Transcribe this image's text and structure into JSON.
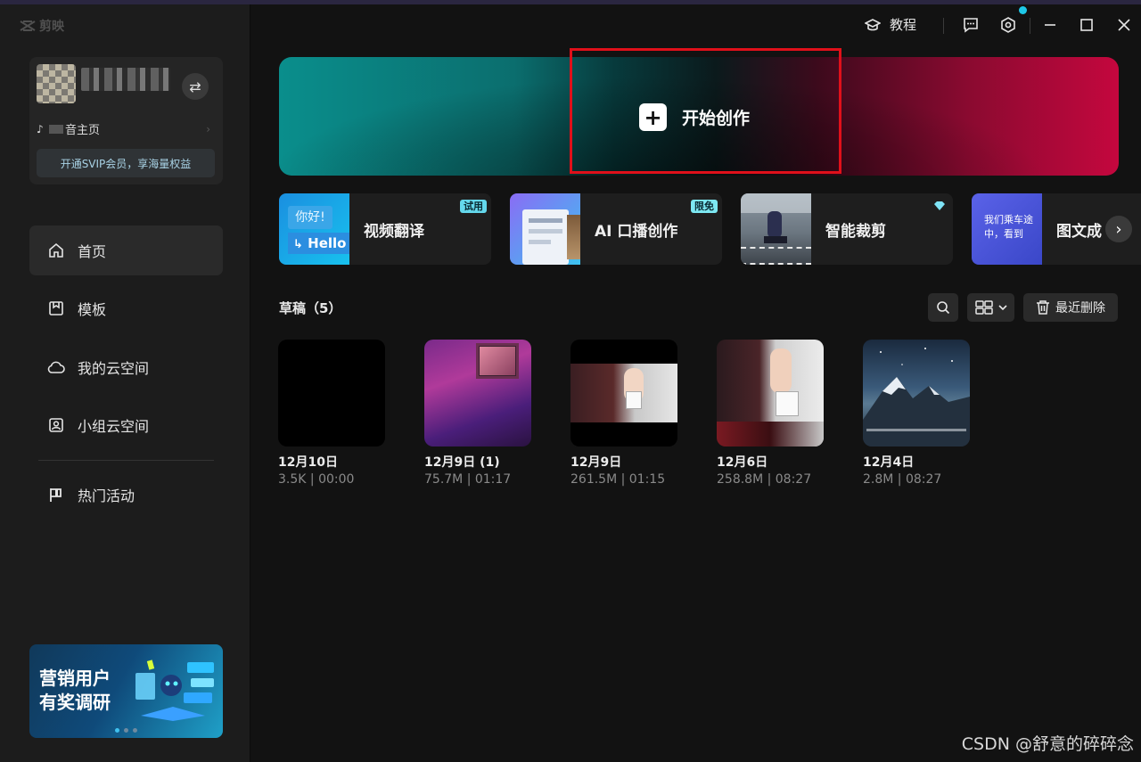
{
  "app": {
    "name": "剪映"
  },
  "titlebar": {
    "tutorial_label": "教程"
  },
  "account": {
    "douyin_label": "音主页",
    "vip_label": "开通SVIP会员，享海量权益"
  },
  "sidebar": {
    "items": [
      {
        "label": "首页",
        "icon": "home-icon"
      },
      {
        "label": "模板",
        "icon": "template-icon"
      },
      {
        "label": "我的云空间",
        "icon": "cloud-icon"
      },
      {
        "label": "小组云空间",
        "icon": "team-cloud-icon"
      },
      {
        "label": "热门活动",
        "icon": "flag-icon"
      }
    ],
    "promo": {
      "title": "营销用户\n有奖调研"
    }
  },
  "hero": {
    "label": "开始创作"
  },
  "features": [
    {
      "label": "视频翻译",
      "badge": "试用",
      "thumb_text_1": "你好!",
      "thumb_text_2": "Hello"
    },
    {
      "label": "AI 口播创作",
      "badge": "限免"
    },
    {
      "label": "智能裁剪",
      "badge_icon": "diamond-icon"
    },
    {
      "label": "图文成",
      "thumb_text": "我们乘车途中，看到"
    }
  ],
  "drafts": {
    "title": "草稿（5）",
    "recent_delete_label": "最近删除",
    "items": [
      {
        "title": "12月10日",
        "meta": "3.5K | 00:00"
      },
      {
        "title": "12月9日 (1)",
        "meta": "75.7M | 01:17"
      },
      {
        "title": "12月9日",
        "meta": "261.5M | 01:15"
      },
      {
        "title": "12月6日",
        "meta": "258.8M | 08:27"
      },
      {
        "title": "12月4日",
        "meta": "2.8M | 08:27"
      }
    ]
  },
  "watermark": "CSDN @舒意的碎碎念",
  "colors": {
    "accent": "#1ec8e8",
    "highlight_border": "#e0101a",
    "badge": "#64d8ec"
  }
}
